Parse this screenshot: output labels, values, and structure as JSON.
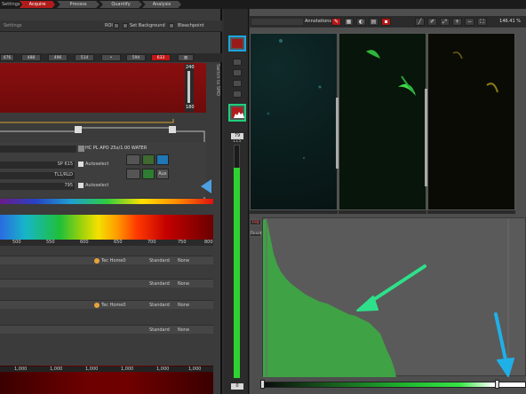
{
  "workflow": {
    "settings_label": "Settings",
    "steps": [
      "Acquire",
      "Process",
      "Quantify",
      "Analysis"
    ],
    "active_step": "Acquire"
  },
  "left": {
    "roi_label": "ROI",
    "set_background_label": "Set Background",
    "bleachpoint_label": "Bleachpoint",
    "channel_tabs": [
      "476",
      "488",
      "496",
      "514",
      "",
      "594",
      "633",
      ""
    ],
    "active_channel": "633",
    "slider_values": [
      "240",
      "180"
    ],
    "side_label": "Switch to SMD",
    "objective": "HC PL APO   25x/1.00 WATER",
    "filter1": "SP 615",
    "filter2": "TL1/RLD",
    "filter3": "795",
    "autoselect_label": "Autoselect",
    "aux_label": "Aux",
    "spectrum_ticks": [
      "500",
      "550",
      "600",
      "650",
      "700",
      "750",
      "800"
    ],
    "detectors": [
      {
        "mode": "Standard",
        "shape": "None",
        "label": "Tec Home0"
      },
      {
        "mode": "Standard",
        "shape": "None",
        "label": ""
      },
      {
        "mode": "Standard",
        "shape": "None",
        "label": "Tec Home0"
      },
      {
        "mode": "Standard",
        "shape": "None",
        "label": ""
      }
    ],
    "bottom_ticks": [
      "1,000",
      "1,000",
      "1,000",
      "1,000",
      "1,000",
      "1,000"
    ]
  },
  "mid": {
    "top_value": "115",
    "mid_value": "79",
    "bottom_value": "0",
    "gauge_fraction": 0.9
  },
  "viewer": {
    "annotations_label": "Annotations",
    "zoom": "146.41 %",
    "log_label": "Log",
    "reset_label": "Reset"
  },
  "colors": {
    "active_red": "#b01c1c",
    "highlight_blue": "#1aa6e0",
    "highlight_green": "#1ecf7a",
    "histogram_green": "#3ea645",
    "arrow_green": "#2ee08a",
    "arrow_blue": "#1fb0e8"
  }
}
